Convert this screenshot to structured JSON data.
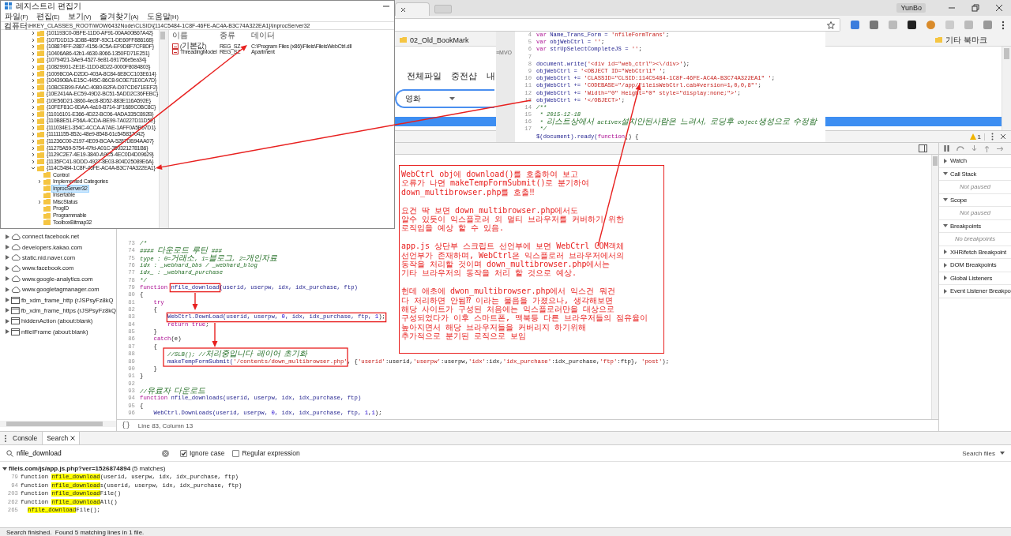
{
  "registry_editor": {
    "title": "레지스트리 편집기",
    "menu": [
      "파일(F)",
      "편집(E)",
      "보기(V)",
      "즐겨찾기(A)",
      "도움말(H)"
    ],
    "address": "컴퓨터\\HKEY_CLASSES_ROOT\\WOW6432Node\\CLSID\\{114C5484-1C8F-46FE-AC4A-B3C74A322EA1}\\InprocServer32",
    "tree": [
      {
        "label": "{101193C0-0BFE-11D0-AF91-00AA00B67A42}",
        "expanded": false,
        "selected": false
      },
      {
        "label": "{107D1D13-1D88-485F-93C1-DE60FF886168}",
        "expanded": false,
        "selected": false
      },
      {
        "label": "{108874FF-2887-4156-9C5A-EF9D8F7CF8DF}",
        "expanded": false,
        "selected": false
      },
      {
        "label": "{10406A86-42b1-4630-8066-1350FD71E251}",
        "expanded": false,
        "selected": false
      },
      {
        "label": "{10794f21-3Ae9-4527-9e81-691756e5ea34}",
        "expanded": false,
        "selected": false
      },
      {
        "label": "{10829901-2E1E-11D0-8D22-0000F8084803}",
        "expanded": false,
        "selected": false
      },
      {
        "label": "{10098C0A-D2DD-403A-8C84-6E8CC103E614}",
        "expanded": false,
        "selected": false
      },
      {
        "label": "{104390BA-E15C-445C-86C8-9C0E71E0CA7D}",
        "expanded": false,
        "selected": false
      },
      {
        "label": "{10BCEB99-FAAC-4080-B2FA-D07CD671EEF2}",
        "expanded": false,
        "selected": false
      },
      {
        "label": "{10E2414A-EC59-49D2-BC51-5ADD2C36FEBC}",
        "expanded": false,
        "selected": false
      },
      {
        "label": "{10E56D21-3860-4ec8-8D52-883E116A592E}",
        "expanded": false,
        "selected": false
      },
      {
        "label": "{10FEF81C-0DAA-4a10-B714-1F1689C0BC8C}",
        "expanded": false,
        "selected": false
      },
      {
        "label": "{11016101-E366-4D22-BC06-4ADA335C892B}",
        "expanded": false,
        "selected": false
      },
      {
        "label": "{110B8E51-F56A-4CDA-BE99-7A0227D11D5E}",
        "expanded": false,
        "selected": false
      },
      {
        "label": "{111034E1-354C-4CCA-A7AE-1AFF0A5B57D1}",
        "expanded": false,
        "selected": false
      },
      {
        "label": "{11111155-852c-48e9-8548-61c545837042}",
        "expanded": false,
        "selected": false
      },
      {
        "label": "{11236C00-2197-4E09-BCAA-5287DB94AA07}",
        "expanded": false,
        "selected": false
      },
      {
        "label": "{11275A59-5754-47fd-A01C-3503212781B6}",
        "expanded": false,
        "selected": false
      },
      {
        "label": "{1129C2E7-4E19-3840-A9C5-4EC0D4D09629}",
        "expanded": false,
        "selected": false
      },
      {
        "label": "{1135FC41-9DDD-4927-8E03-804D25089E6A}",
        "expanded": false,
        "selected": false
      },
      {
        "label": "{114C5484-1C8F-46FE-AC4A-B3C74A322EA1}",
        "expanded": true,
        "selected": false,
        "children": [
          {
            "label": "Control",
            "expandable": false,
            "selected": false
          },
          {
            "label": "Implemented Categories",
            "expandable": true,
            "selected": false
          },
          {
            "label": "InprocServer32",
            "expandable": false,
            "selected": true
          },
          {
            "label": "Insertable",
            "expandable": false,
            "selected": false
          },
          {
            "label": "MiscStatus",
            "expandable": true,
            "selected": false
          },
          {
            "label": "ProgID",
            "expandable": false,
            "selected": false
          },
          {
            "label": "Programmable",
            "expandable": false,
            "selected": false
          },
          {
            "label": "ToolboxBitmap32",
            "expandable": false,
            "selected": false
          }
        ]
      }
    ],
    "columns": [
      "이름",
      "종류",
      "데이터"
    ],
    "values": [
      {
        "name": "(기본값)",
        "type": "REG_SZ",
        "data": "C:\\Program Files (x86)\\Fileis\\FileisWebCtrl.dll"
      },
      {
        "name": "ThreadingModel",
        "type": "REG_SZ",
        "data": "Apartment"
      }
    ]
  },
  "browser": {
    "profile": "YunBo",
    "bookmarks": [
      "02_Old_BookMark"
    ],
    "other_bookmarks": "기타 북마크",
    "page": {
      "nav": [
        "전체파일",
        "중전샵",
        "내"
      ],
      "category": "영화"
    }
  },
  "code_snippet": {
    "tab": "≡MVO",
    "lines": [
      {
        "n": "4",
        "t": [
          {
            "kind": "kw",
            "text": "var "
          },
          {
            "kind": "id",
            "text": "Name_Trans_Form = "
          },
          {
            "kind": "str",
            "text": "'nfileFormTrans'"
          },
          {
            "kind": "p",
            "text": ";"
          }
        ]
      },
      {
        "n": "5",
        "t": [
          {
            "kind": "kw",
            "text": "var "
          },
          {
            "kind": "id",
            "text": "objWebCtrl = "
          },
          {
            "kind": "str",
            "text": "''"
          },
          {
            "kind": "p",
            "text": ";"
          }
        ]
      },
      {
        "n": "6",
        "t": [
          {
            "kind": "kw",
            "text": "var "
          },
          {
            "kind": "id",
            "text": "strUpSelectCompleteJS = "
          },
          {
            "kind": "str",
            "text": "''"
          },
          {
            "kind": "p",
            "text": ";"
          }
        ]
      },
      {
        "n": "7"
      },
      {
        "n": "8",
        "t": [
          {
            "kind": "id",
            "text": "document.write("
          },
          {
            "kind": "str",
            "text": "'<div id=\"web_ctrl\"><\\/div>'"
          },
          {
            "kind": "p",
            "text": ");"
          }
        ]
      },
      {
        "n": "9",
        "t": [
          {
            "kind": "id",
            "text": "objWebCtrl = "
          },
          {
            "kind": "str",
            "text": "'<OBJECT ID=\"WebCtrl1\" '"
          },
          {
            "kind": "p",
            "text": ";"
          }
        ]
      },
      {
        "n": "10",
        "t": [
          {
            "kind": "id",
            "text": "objWebCtrl += "
          },
          {
            "kind": "str",
            "text": "'CLASSID=\"CLSID:114C5484-1C8F-46FE-AC4A-B3C74A322EA1\" '"
          },
          {
            "kind": "p",
            "text": ";"
          }
        ]
      },
      {
        "n": "11",
        "t": [
          {
            "kind": "id",
            "text": "objWebCtrl += "
          },
          {
            "kind": "str",
            "text": "'CODEBASE=\"/app/FileisWebCtrl.cab#version=1,0,0,8\"'"
          },
          {
            "kind": "p",
            "text": ";"
          }
        ]
      },
      {
        "n": "12",
        "t": [
          {
            "kind": "id",
            "text": "objWebCtrl += "
          },
          {
            "kind": "str",
            "text": "'Width=\"0\" Height=\"0\" style=\"display:none;\">'"
          },
          {
            "kind": "p",
            "text": ";"
          }
        ]
      },
      {
        "n": "13",
        "t": [
          {
            "kind": "id",
            "text": "objWebCtrl += "
          },
          {
            "kind": "str",
            "text": "'</OBJECT>'"
          },
          {
            "kind": "p",
            "text": ";"
          }
        ]
      },
      {
        "n": "14",
        "t": [
          {
            "kind": "cm",
            "text": "/**"
          }
        ]
      },
      {
        "n": "15",
        "t": [
          {
            "kind": "cm",
            "text": " * 2015-12-18"
          }
        ]
      },
      {
        "n": "16",
        "t": [
          {
            "kind": "cm",
            "text": " * 리스트상에서 activex설치안된사람은 느려서, 로딩후 object생성으로 수정함"
          }
        ]
      },
      {
        "n": "17",
        "t": [
          {
            "kind": "cm",
            "text": " */"
          }
        ]
      },
      {
        "t": [
          {
            "kind": "id",
            "text": "$(document).ready("
          },
          {
            "kind": "kw",
            "text": "function"
          },
          {
            "kind": "p",
            "text": "() {"
          }
        ]
      }
    ]
  },
  "devtools": {
    "warnings": "1",
    "navigator": [
      {
        "label": "connect.facebook.net",
        "kind": "domain"
      },
      {
        "label": "developers.kakao.com",
        "kind": "domain"
      },
      {
        "label": "static.nid.naver.com",
        "kind": "domain"
      },
      {
        "label": "www.facebook.com",
        "kind": "domain"
      },
      {
        "label": "www.google-analytics.com",
        "kind": "domain"
      },
      {
        "label": "www.googletagmanager.com",
        "kind": "domain"
      },
      {
        "label": "fb_xdm_frame_http (rJSPsyFz8kQ",
        "kind": "frame"
      },
      {
        "label": "fb_xdm_frame_https (rJSPsyFz8kQ",
        "kind": "frame"
      },
      {
        "label": "hiddenAction (about:blank)",
        "kind": "frame"
      },
      {
        "label": "nfileIFrame (about:blank)",
        "kind": "frame"
      }
    ],
    "editor": {
      "lines": [
        {
          "n": "73",
          "t": [
            {
              "kind": "cm",
              "text": "/*"
            }
          ]
        },
        {
          "n": "74",
          "t": [
            {
              "kind": "cm",
              "text": "#### 다운로드 루틴 ###"
            }
          ]
        },
        {
          "n": "75",
          "t": [
            {
              "kind": "cm",
              "text": "type : 0=거래소, 1=블로그, 2=개인자료"
            }
          ]
        },
        {
          "n": "76",
          "t": [
            {
              "kind": "cm",
              "text": "idx : _webhard_bbs / _webhard_blog"
            }
          ]
        },
        {
          "n": "77",
          "t": [
            {
              "kind": "cm",
              "text": "idx_ : _webhard_purchase"
            }
          ]
        },
        {
          "n": "78",
          "t": [
            {
              "kind": "cm",
              "text": "*/"
            }
          ]
        },
        {
          "n": "79",
          "t": [
            {
              "kind": "kw",
              "text": "function "
            },
            {
              "kind": "id",
              "text": "nfile_download",
              "boxed": true
            },
            {
              "kind": "id",
              "text": "(userid, userpw, idx, idx_purchase, ftp)"
            }
          ]
        },
        {
          "n": "80",
          "t": [
            {
              "kind": "p",
              "text": "{"
            }
          ]
        },
        {
          "n": "81",
          "t": [
            {
              "kind": "kw",
              "text": "    try"
            }
          ]
        },
        {
          "n": "82",
          "t": [
            {
              "kind": "p",
              "text": "    {"
            }
          ]
        },
        {
          "n": "83",
          "t": [
            {
              "kind": "id",
              "text": "        WebCtrl.DownLoad(userid, userpw, ",
              "boxed": true
            },
            {
              "kind": "num",
              "text": "0",
              "boxed": true
            },
            {
              "kind": "id",
              "text": ", idx, idx_purchase, ftp, ",
              "boxed": true
            },
            {
              "kind": "num",
              "text": "1",
              "boxed": true
            },
            {
              "kind": "p",
              "text": ");",
              "boxed": true
            }
          ]
        },
        {
          "n": "84",
          "t": [
            {
              "kind": "kw",
              "text": "        return true"
            },
            {
              "kind": "p",
              "text": ";"
            }
          ]
        },
        {
          "n": "85",
          "t": [
            {
              "kind": "p",
              "text": "    }"
            }
          ]
        },
        {
          "n": "86",
          "t": [
            {
              "kind": "kw",
              "text": "    catch"
            },
            {
              "kind": "p",
              "text": "(e)"
            }
          ]
        },
        {
          "n": "87",
          "t": [
            {
              "kind": "p",
              "text": "    {"
            }
          ]
        },
        {
          "n": "88",
          "t": [
            {
              "kind": "cm",
              "text": "        //SLB(); //처리중입니다 레이어 초기화"
            }
          ]
        },
        {
          "n": "89",
          "t": [
            {
              "kind": "id",
              "text": "        makeTempFormSubmit("
            },
            {
              "kind": "str",
              "text": "'/contents/down_multibrowser.php'"
            },
            {
              "kind": "p",
              "text": ", {"
            },
            {
              "kind": "str",
              "text": "'userid'"
            },
            {
              "kind": "p",
              "text": ":userid,"
            },
            {
              "kind": "str",
              "text": "'userpw'"
            },
            {
              "kind": "p",
              "text": ":userpw,"
            },
            {
              "kind": "str",
              "text": "'idx'"
            },
            {
              "kind": "p",
              "text": ":idx,"
            },
            {
              "kind": "str",
              "text": "'idx_purchase'"
            },
            {
              "kind": "p",
              "text": ":idx_purchase,"
            },
            {
              "kind": "str",
              "text": "'ftp'"
            },
            {
              "kind": "p",
              "text": ":ftp}, "
            },
            {
              "kind": "str",
              "text": "'post'"
            },
            {
              "kind": "p",
              "text": ");"
            }
          ]
        },
        {
          "n": "90",
          "t": [
            {
              "kind": "p",
              "text": "    }"
            }
          ]
        },
        {
          "n": "91",
          "t": [
            {
              "kind": "p",
              "text": "}"
            }
          ]
        },
        {
          "n": "92"
        },
        {
          "n": "93",
          "t": [
            {
              "kind": "cm",
              "text": "//유료자 다운로드"
            }
          ]
        },
        {
          "n": "94",
          "t": [
            {
              "kind": "kw",
              "text": "function "
            },
            {
              "kind": "id",
              "text": "nfile_downloads(userid, userpw, idx, idx_purchase, ftp)"
            }
          ]
        },
        {
          "n": "95",
          "t": [
            {
              "kind": "p",
              "text": "{"
            }
          ]
        },
        {
          "n": "96",
          "t": [
            {
              "kind": "id",
              "text": "    WebCtrl.DownLoads(userid, userpw, "
            },
            {
              "kind": "num",
              "text": "0"
            },
            {
              "kind": "id",
              "text": ", idx, idx_purchase, ftp, "
            },
            {
              "kind": "num",
              "text": "1"
            },
            {
              "kind": "p",
              "text": ","
            },
            {
              "kind": "num",
              "text": "1"
            },
            {
              "kind": "p",
              "text": ");"
            }
          ]
        }
      ],
      "format_button": "{}",
      "status": "Line 83, Column 13"
    },
    "sidebar": [
      {
        "label": "Watch",
        "expanded": false
      },
      {
        "label": "Call Stack",
        "expanded": true,
        "note": "Not paused"
      },
      {
        "label": "Scope",
        "expanded": true,
        "note": "Not paused"
      },
      {
        "label": "Breakpoints",
        "expanded": true,
        "note": "No breakpoints"
      },
      {
        "label": "XHR/fetch Breakpoint",
        "expanded": false
      },
      {
        "label": "DOM Breakpoints",
        "expanded": false
      },
      {
        "label": "Global Listeners",
        "expanded": false
      },
      {
        "label": "Event Listener Breakpo",
        "expanded": false
      }
    ],
    "drawer": {
      "tabs": [
        {
          "label": "Console",
          "selected": false,
          "closable": false
        },
        {
          "label": "Search",
          "selected": true,
          "closable": true
        }
      ],
      "query": "nfile_download",
      "options": [
        {
          "label": "Ignore case",
          "checked": true
        },
        {
          "label": "Regular expression",
          "checked": false
        }
      ],
      "scope": "Search files",
      "file": "fileis.com/js/app.js.php?ver=1526874894",
      "matches": "(5 matches)",
      "results": [
        {
          "line": "79",
          "before": "function ",
          "match": "nfile_download",
          "after": "(userid, userpw, idx, idx_purchase, ftp)"
        },
        {
          "line": "94",
          "before": "function ",
          "match": "nfile_download",
          "after": "s(userid, userpw, idx, idx_purchase, ftp)"
        },
        {
          "line": "203",
          "before": "function ",
          "match": "nfile_download",
          "after": "File()"
        },
        {
          "line": "262",
          "before": "function ",
          "match": "nfile_download",
          "after": "All()"
        },
        {
          "line": "265",
          "match": "nfile_download",
          "after": "File();"
        }
      ],
      "status": "Search finished.  Found 5 matching lines in 1 file."
    }
  },
  "annotation": {
    "paragraphs": [
      "WebCtrl obj에 download()를 호출하여 보고\n오류가 나면 makeTempFormSubmit()로 분기하여\ndown_multibrowser.php를 호출‼",
      "요건 딱 보면 down_multibrowser.php에서도\n알수 있듯이 익스플로러 외 멀티 브라우저를 커버하기 위한\n로직임을 예상 할 수 있음.",
      "app.js 상단부 스크립트 선언부에 보면 WebCtrl COM객체\n선언부가 존재하며, WebCtrl은 익스플로러 브라우저에서의\n동작을 처리할 것이며 down_multibrowser.php에서는\n기타 브라우저의 동작을 처리 할 것으로 예상.",
      "헌데 애초에 dwon_multibrowser.php에서 익스건 뭐건\n다 처리하면 안됨⁇ 이라는 물음을 가졌으나, 생각해보면\n해당 사이트가 구성된 처음에는 익스플로러만을 대상으로\n구성되었다가 이후 스마트폰, 맥북등 다른 브라우저들의 점유율이\n높아지면서 해당 브라우저들을 커버리지 하기위해\n추가적으로 분기된 로직으로 보임"
    ]
  }
}
